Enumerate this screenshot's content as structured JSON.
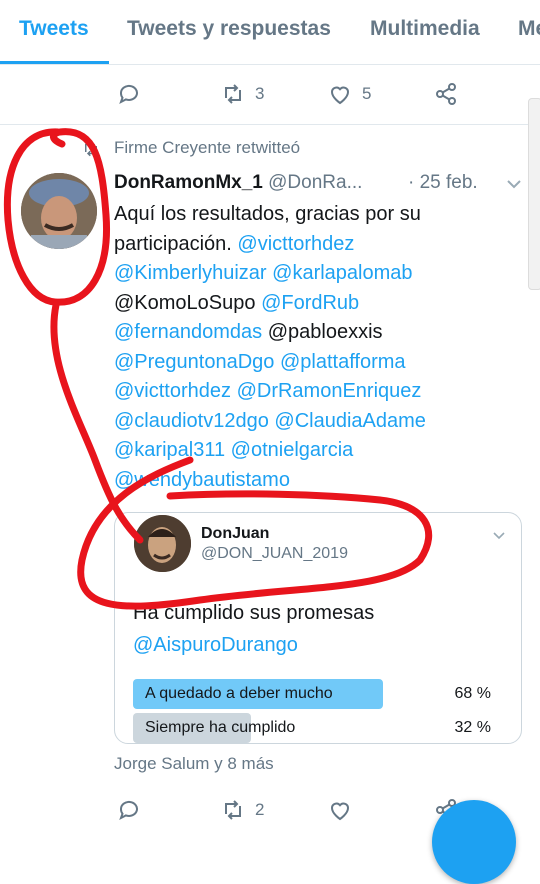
{
  "tabs": [
    "Tweets",
    "Tweets y respuestas",
    "Multimedia",
    "Me"
  ],
  "top_actions": {
    "retweets": "3",
    "likes": "5"
  },
  "retweet_context": "Firme Creyente retwitteó",
  "tweet": {
    "name": "DonRamonMx_1",
    "handle": "@DonRa...",
    "date": "· 25 feb.",
    "lines": [
      [
        {
          "t": "Aquí los resultados, gracias por su",
          "m": false
        }
      ],
      [
        {
          "t": "participación. ",
          "m": false
        },
        {
          "t": "@victtorhdez",
          "m": true
        }
      ],
      [
        {
          "t": "@Kimberlyhuizar",
          "m": true
        },
        {
          "t": " ",
          "m": false
        },
        {
          "t": "@karlapalomab",
          "m": true
        }
      ],
      [
        {
          "t": "@KomoLoSupo ",
          "m": false
        },
        {
          "t": "@FordRub",
          "m": true
        }
      ],
      [
        {
          "t": "@fernandomdas",
          "m": true
        },
        {
          "t": " @pabloexxis",
          "m": false
        }
      ],
      [
        {
          "t": "@PreguntonaDgo",
          "m": true
        },
        {
          "t": " ",
          "m": false
        },
        {
          "t": "@plattafforma",
          "m": true
        }
      ],
      [
        {
          "t": "@victtorhdez",
          "m": true
        },
        {
          "t": " ",
          "m": false
        },
        {
          "t": "@DrRamonEnriquez",
          "m": true
        }
      ],
      [
        {
          "t": "@claudiotv12dgo",
          "m": true
        },
        {
          "t": " ",
          "m": false
        },
        {
          "t": "@ClaudiaAdame",
          "m": true
        }
      ],
      [
        {
          "t": "@karipal311",
          "m": true
        },
        {
          "t": " ",
          "m": false
        },
        {
          "t": "@otnielgarcia",
          "m": true
        }
      ],
      [
        {
          "t": "@wendybautistamo",
          "m": true
        }
      ]
    ]
  },
  "quoted": {
    "name": "DonJuan",
    "handle": "@DON_JUAN_2019",
    "text": "Ha cumplido sus promesas",
    "mention": "@AispuroDurango",
    "poll": [
      {
        "label": "A quedado a deber mucho",
        "percent": "68 %",
        "value": 0.68,
        "leading": true
      },
      {
        "label": "Siempre ha cumplido",
        "percent": "32 %",
        "value": 0.32,
        "leading": false
      }
    ]
  },
  "votes_text": "Jorge Salum y 8 más",
  "bottom_actions": {
    "retweets": "2"
  },
  "colors": {
    "accent": "#1da1f2",
    "muted": "#657786",
    "annotation": "#e8141c",
    "poll_leading": "#71c9f8",
    "poll_other": "#ccd6dd"
  }
}
